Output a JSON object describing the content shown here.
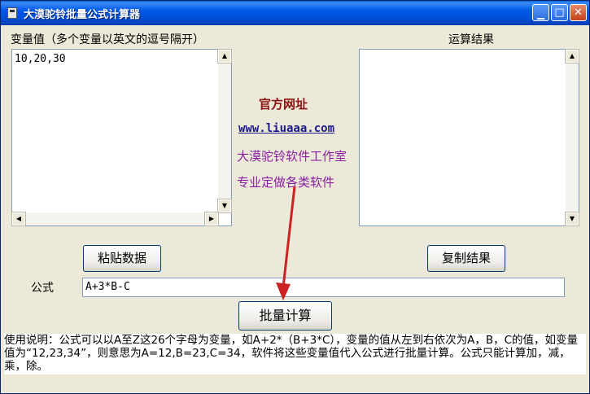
{
  "window": {
    "title": "大漠驼铃批量公式计算器"
  },
  "titlebar_buttons": [
    {
      "name": "minimize",
      "glyph": "▁"
    },
    {
      "name": "maximize",
      "glyph": "□"
    },
    {
      "name": "close",
      "glyph": "✕"
    }
  ],
  "variables": {
    "label": "变量值（多个变量以英文的逗号隔开）",
    "value": "10,20,30"
  },
  "results": {
    "label": "运算结果",
    "value": ""
  },
  "info": {
    "official_site_label": "官方网址",
    "url": "www.liuaaa.com",
    "studio": "大漠驼铃软件工作室",
    "slogan": "专业定做各类软件"
  },
  "buttons": {
    "paste": "粘贴数据",
    "copy": "复制结果",
    "calculate": "批量计算"
  },
  "formula": {
    "label": "公式",
    "value": "A+3*B-C"
  },
  "instructions": "使用说明：公式可以以A至Z这26个字母为变量，如A+2*（B+3*C），变量的值从左到右依次为A，B，C的值，如变量值为“12,23,34”，则意思为A=12,B=23,C=34，软件将这些变量值代入公式进行批量计算。公式只能计算加，减，乘，除。",
  "colors": {
    "title_red": "#8b1010",
    "url_blue": "#1a1a8c",
    "purple": "#8a1ea0",
    "arrow_red": "#cc2222"
  }
}
